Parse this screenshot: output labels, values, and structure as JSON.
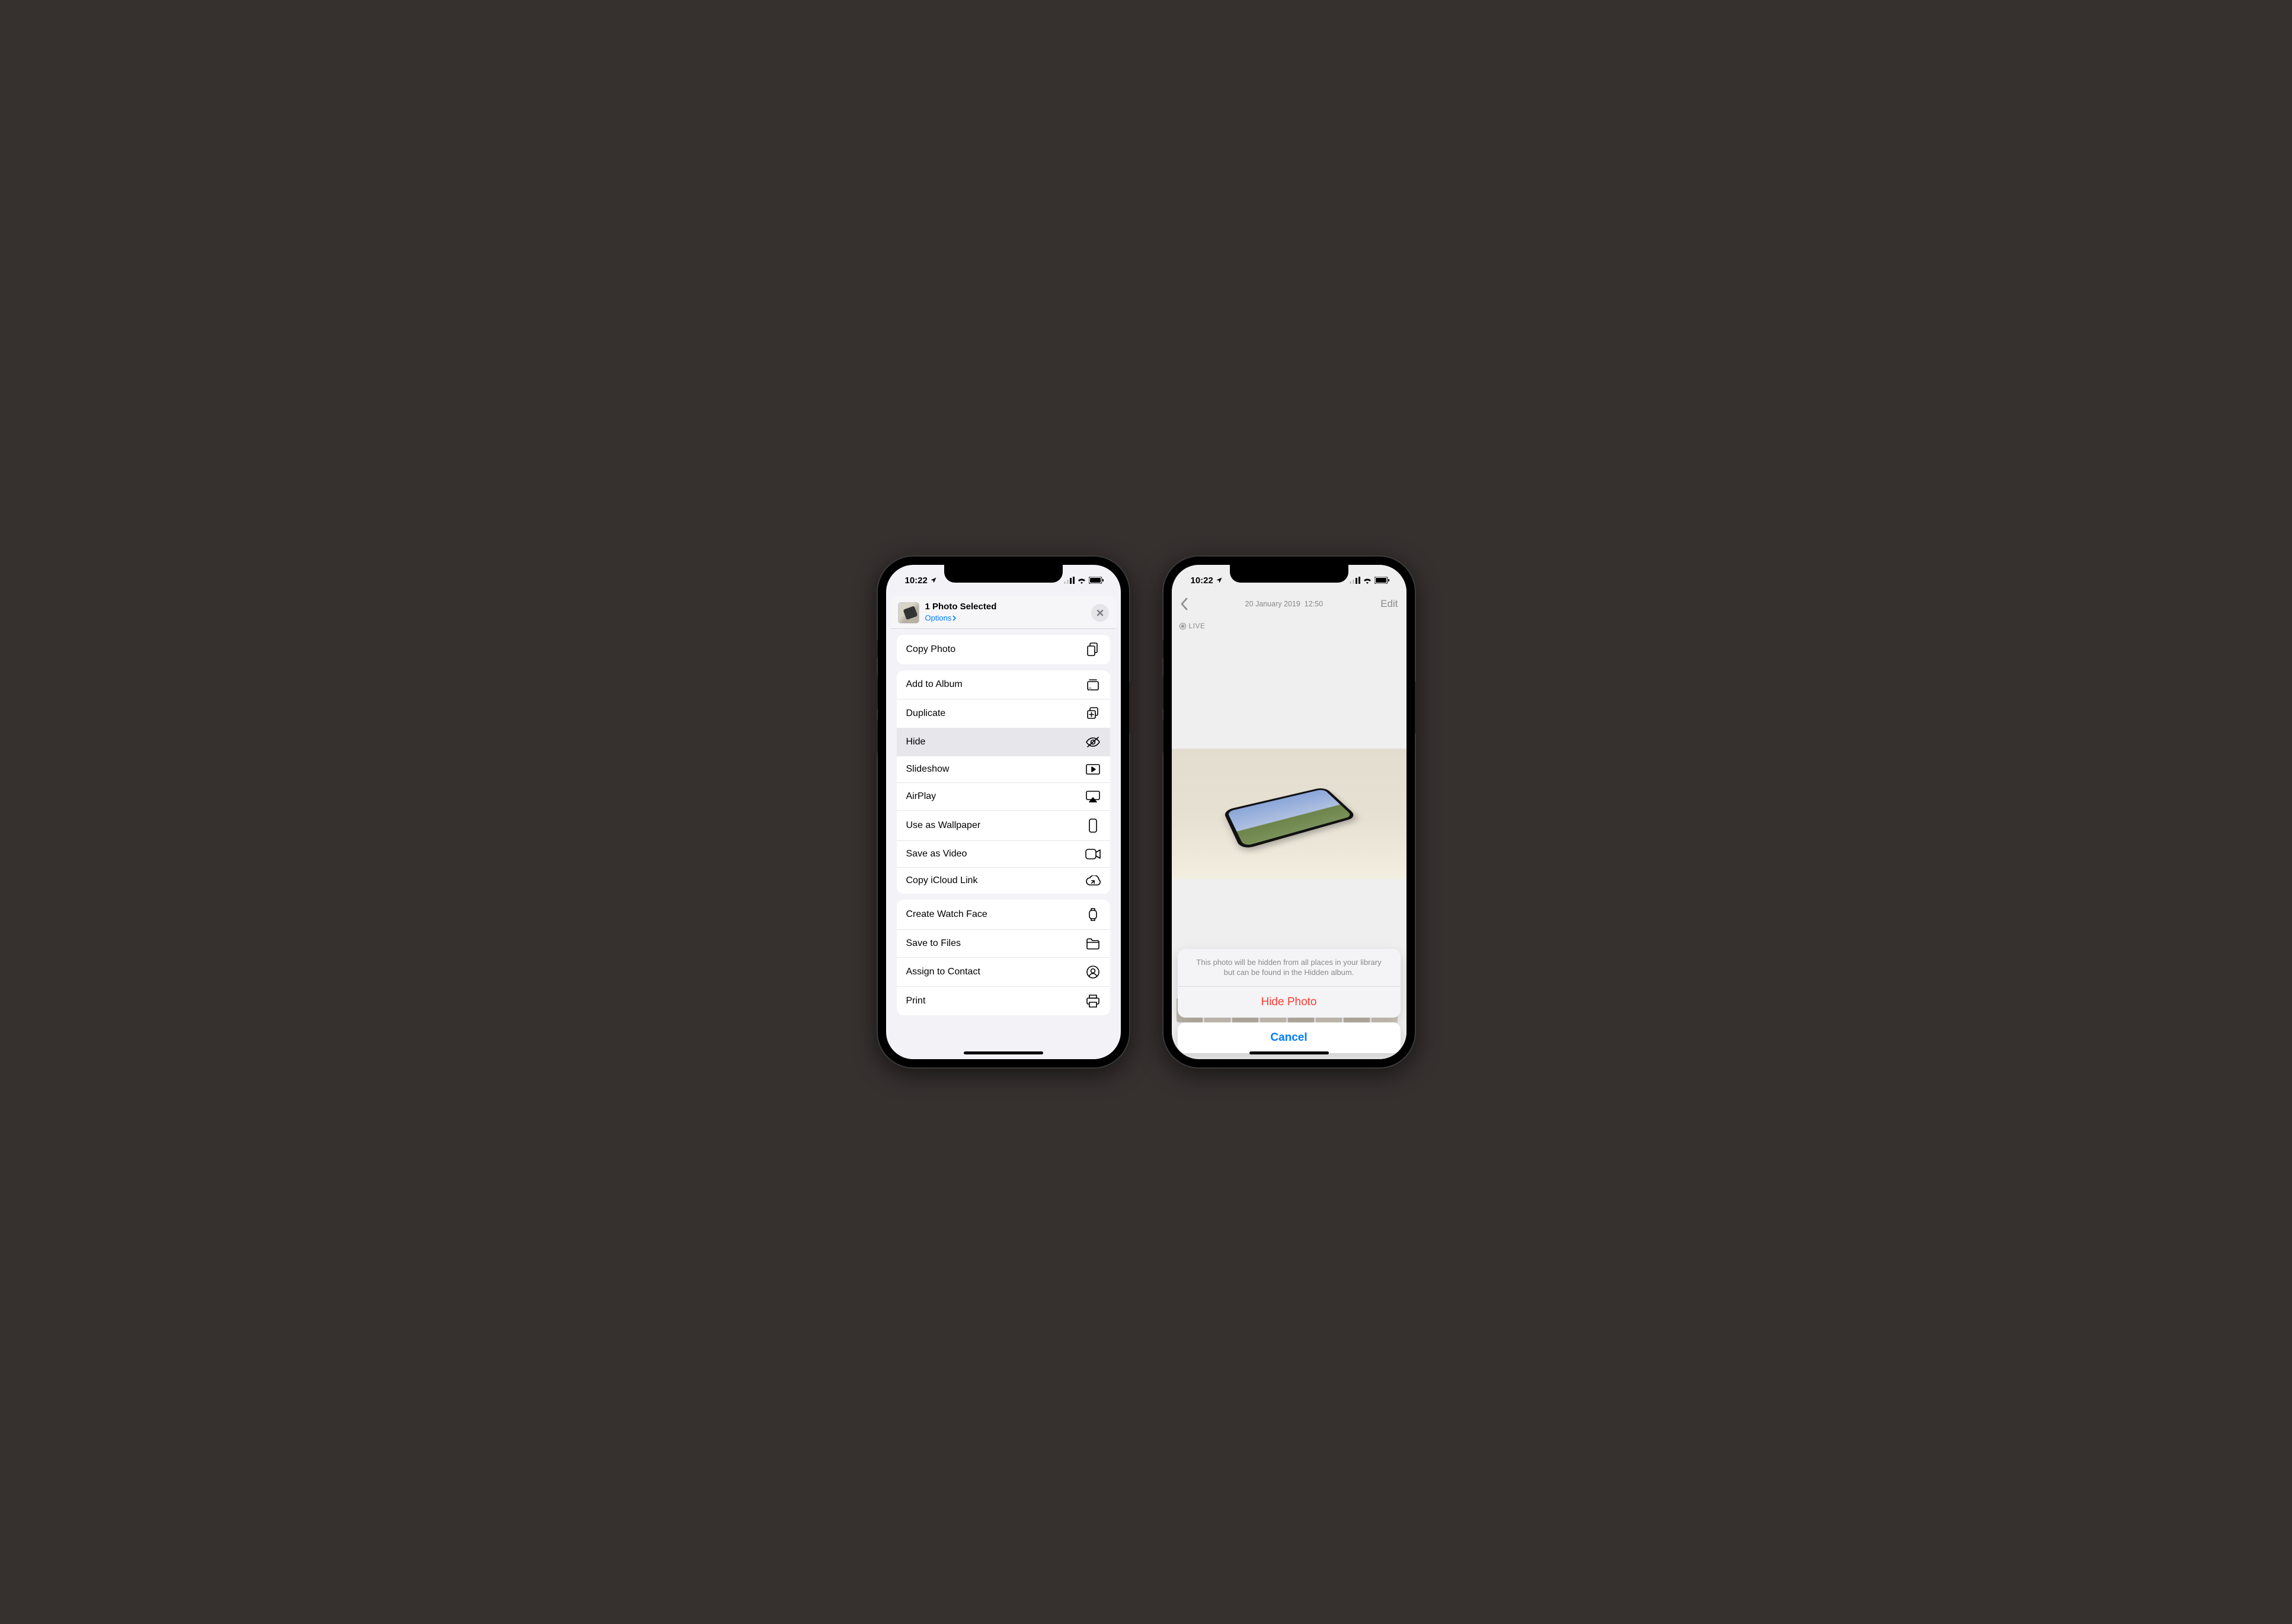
{
  "status": {
    "time": "10:22"
  },
  "share": {
    "title": "1 Photo Selected",
    "options_label": "Options",
    "actions_group1": [
      {
        "label": "Copy Photo",
        "icon": "docs"
      }
    ],
    "actions_group2": [
      {
        "label": "Add to Album",
        "icon": "album"
      },
      {
        "label": "Duplicate",
        "icon": "duplicate"
      },
      {
        "label": "Hide",
        "icon": "hide",
        "highlight": true
      },
      {
        "label": "Slideshow",
        "icon": "play"
      },
      {
        "label": "AirPlay",
        "icon": "airplay"
      },
      {
        "label": "Use as Wallpaper",
        "icon": "wallpaper"
      },
      {
        "label": "Save as Video",
        "icon": "video"
      },
      {
        "label": "Copy iCloud Link",
        "icon": "cloudlink"
      }
    ],
    "actions_group3": [
      {
        "label": "Create Watch Face",
        "icon": "watch"
      },
      {
        "label": "Save to Files",
        "icon": "folder"
      },
      {
        "label": "Assign to Contact",
        "icon": "contact"
      },
      {
        "label": "Print",
        "icon": "print"
      }
    ]
  },
  "viewer": {
    "date": "20 January 2019",
    "time": "12:50",
    "edit_label": "Edit",
    "live_label": "LIVE",
    "sheet_message": "This photo will be hidden from all places in your library but can be found in the Hidden album.",
    "hide_label": "Hide Photo",
    "cancel_label": "Cancel"
  }
}
